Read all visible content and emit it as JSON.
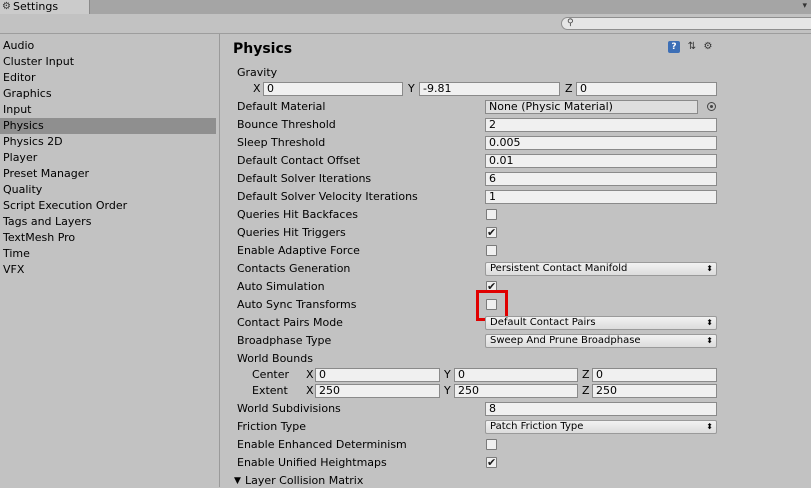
{
  "window": {
    "tab_title": "Settings"
  },
  "sidebar": {
    "items": [
      {
        "label": "Audio"
      },
      {
        "label": "Cluster Input"
      },
      {
        "label": "Editor"
      },
      {
        "label": "Graphics"
      },
      {
        "label": "Input"
      },
      {
        "label": "Physics"
      },
      {
        "label": "Physics 2D"
      },
      {
        "label": "Player"
      },
      {
        "label": "Preset Manager"
      },
      {
        "label": "Quality"
      },
      {
        "label": "Script Execution Order"
      },
      {
        "label": "Tags and Layers"
      },
      {
        "label": "TextMesh Pro"
      },
      {
        "label": "Time"
      },
      {
        "label": "VFX"
      }
    ],
    "selected": "Physics"
  },
  "main": {
    "title": "Physics",
    "gravity": {
      "label": "Gravity",
      "x_label": "X",
      "x": "0",
      "y_label": "Y",
      "y": "-9.81",
      "z_label": "Z",
      "z": "0"
    },
    "default_material": {
      "label": "Default Material",
      "value": "None (Physic Material)"
    },
    "bounce_threshold": {
      "label": "Bounce Threshold",
      "value": "2"
    },
    "sleep_threshold": {
      "label": "Sleep Threshold",
      "value": "0.005"
    },
    "default_contact_offset": {
      "label": "Default Contact Offset",
      "value": "0.01"
    },
    "default_solver_iterations": {
      "label": "Default Solver Iterations",
      "value": "6"
    },
    "default_solver_velocity_iterations": {
      "label": "Default Solver Velocity Iterations",
      "value": "1"
    },
    "queries_hit_backfaces": {
      "label": "Queries Hit Backfaces",
      "checked": false
    },
    "queries_hit_triggers": {
      "label": "Queries Hit Triggers",
      "checked": true
    },
    "enable_adaptive_force": {
      "label": "Enable Adaptive Force",
      "checked": false
    },
    "contacts_generation": {
      "label": "Contacts Generation",
      "value": "Persistent Contact Manifold"
    },
    "auto_simulation": {
      "label": "Auto Simulation",
      "checked": true
    },
    "auto_sync_transforms": {
      "label": "Auto Sync Transforms",
      "checked": false
    },
    "contact_pairs_mode": {
      "label": "Contact Pairs Mode",
      "value": "Default Contact Pairs"
    },
    "broadphase_type": {
      "label": "Broadphase Type",
      "value": "Sweep And Prune Broadphase"
    },
    "world_bounds": {
      "label": "World Bounds",
      "center_label": "Center",
      "center": {
        "x_label": "X",
        "x": "0",
        "y_label": "Y",
        "y": "0",
        "z_label": "Z",
        "z": "0"
      },
      "extent_label": "Extent",
      "extent": {
        "x_label": "X",
        "x": "250",
        "y_label": "Y",
        "y": "250",
        "z_label": "Z",
        "z": "250"
      }
    },
    "world_subdivisions": {
      "label": "World Subdivisions",
      "value": "8"
    },
    "friction_type": {
      "label": "Friction Type",
      "value": "Patch Friction Type"
    },
    "enable_enhanced_determinism": {
      "label": "Enable Enhanced Determinism",
      "checked": false
    },
    "enable_unified_heightmaps": {
      "label": "Enable Unified Heightmaps",
      "checked": true
    },
    "layer_collision_matrix": {
      "label": "Layer Collision Matrix"
    }
  },
  "glyphs": {
    "check": "✔",
    "dropdown_arrows": "⬍",
    "foldout_open": "▼",
    "search": "⚲",
    "tab_gear": "⚙",
    "menu": "▾",
    "help": "?",
    "sliders": "⇅",
    "gear": "⚙"
  },
  "colors": {
    "background": "#c2c2c2",
    "selection": "#8f8f8f",
    "highlight_box": "#e00000",
    "help_icon": "#3d6fb6"
  }
}
